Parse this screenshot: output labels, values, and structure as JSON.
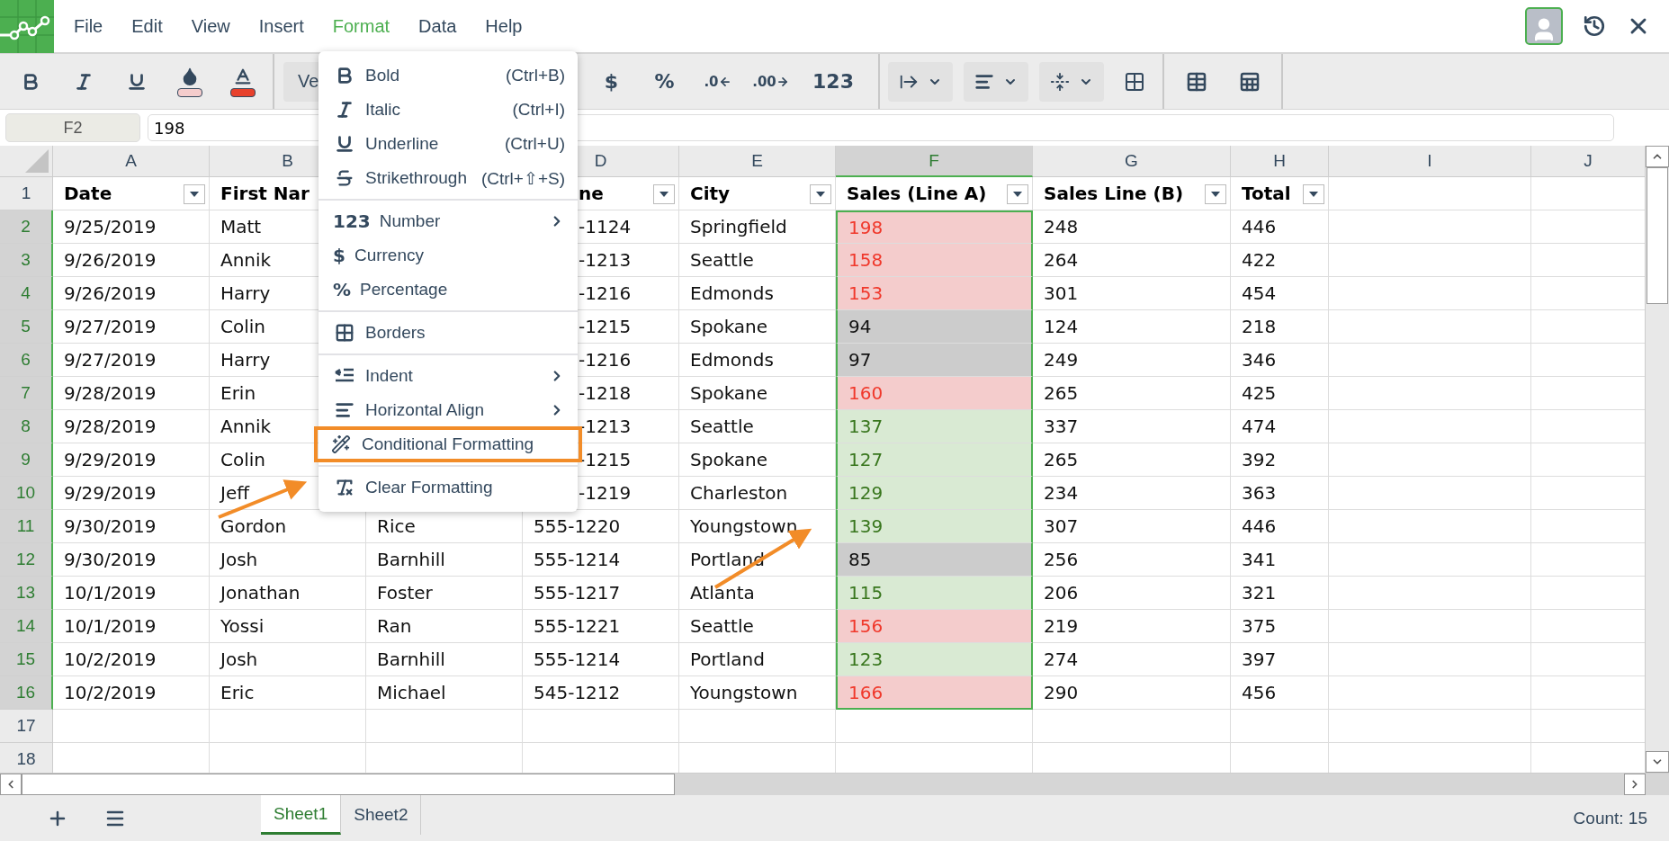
{
  "menu_bar": [
    {
      "label": "File",
      "selected": false
    },
    {
      "label": "Edit",
      "selected": false
    },
    {
      "label": "View",
      "selected": false
    },
    {
      "label": "Insert",
      "selected": false
    },
    {
      "label": "Format",
      "selected": true
    },
    {
      "label": "Data",
      "selected": false
    },
    {
      "label": "Help",
      "selected": false
    }
  ],
  "toolbar": {
    "font_field": "Ve",
    "currency": "$",
    "percent": "%",
    "decrease_decimals": ".0",
    "increase_decimals": ".00",
    "number": "123"
  },
  "name_box": "F2",
  "formula": "198",
  "columns": [
    {
      "label": "A",
      "selected": false
    },
    {
      "label": "B",
      "selected": false
    },
    {},
    {
      "label": "D",
      "selected": false
    },
    {
      "label": "E",
      "selected": false
    },
    {
      "label": "F",
      "selected": true
    },
    {
      "label": "G",
      "selected": false
    },
    {
      "label": "H",
      "selected": false
    },
    {
      "label": "I",
      "selected": false
    },
    {
      "label": "J",
      "selected": false
    }
  ],
  "rows": [
    {
      "number": "1",
      "selected": false,
      "cells": {
        "A": {
          "text": "Date",
          "filter": true
        },
        "B": {
          "text": "First Nar",
          "filter": false
        },
        "D": {
          "text": "ne",
          "filter": true
        },
        "E": {
          "text": "City",
          "filter": true
        },
        "F": {
          "text": "Sales (Line A)",
          "filter": true
        },
        "G": {
          "text": "Sales Line (B)",
          "filter": true
        },
        "H": {
          "text": "Total",
          "filter": true
        }
      }
    },
    {
      "number": "2",
      "selected": true,
      "cells": {
        "A": "9/25/2019",
        "B": "Matt",
        "D": "-1124",
        "E": "Springfield",
        "F": {
          "text": "198",
          "kind": "high"
        },
        "G": "248",
        "H": "446"
      }
    },
    {
      "number": "3",
      "selected": true,
      "cells": {
        "A": "9/26/2019",
        "B": "Annik",
        "D": "-1213",
        "E": "Seattle",
        "F": {
          "text": "158",
          "kind": "high"
        },
        "G": "264",
        "H": "422"
      }
    },
    {
      "number": "4",
      "selected": true,
      "cells": {
        "A": "9/26/2019",
        "B": "Harry",
        "D": "-1216",
        "E": "Edmonds",
        "F": {
          "text": "153",
          "kind": "high"
        },
        "G": "301",
        "H": "454"
      }
    },
    {
      "number": "5",
      "selected": true,
      "cells": {
        "A": "9/27/2019",
        "B": "Colin",
        "D": "-1215",
        "E": "Spokane",
        "F": {
          "text": "94",
          "kind": "low"
        },
        "G": "124",
        "H": "218"
      }
    },
    {
      "number": "6",
      "selected": true,
      "cells": {
        "A": "9/27/2019",
        "B": "Harry",
        "D": "-1216",
        "E": "Edmonds",
        "F": {
          "text": "97",
          "kind": "low"
        },
        "G": "249",
        "H": "346"
      }
    },
    {
      "number": "7",
      "selected": true,
      "cells": {
        "A": "9/28/2019",
        "B": "Erin",
        "D": "-1218",
        "E": "Spokane",
        "F": {
          "text": "160",
          "kind": "high"
        },
        "G": "265",
        "H": "425"
      }
    },
    {
      "number": "8",
      "selected": true,
      "cells": {
        "A": "9/28/2019",
        "B": "Annik",
        "D": "-1213",
        "E": "Seattle",
        "F": {
          "text": "137",
          "kind": "mid"
        },
        "G": "337",
        "H": "474"
      }
    },
    {
      "number": "9",
      "selected": true,
      "cells": {
        "A": "9/29/2019",
        "B": "Colin",
        "D": "-1215",
        "E": "Spokane",
        "F": {
          "text": "127",
          "kind": "mid"
        },
        "G": "265",
        "H": "392"
      }
    },
    {
      "number": "10",
      "selected": true,
      "cells": {
        "A": "9/29/2019",
        "B": "Jeff",
        "D": "-1219",
        "E": "Charleston",
        "F": {
          "text": "129",
          "kind": "mid"
        },
        "G": "234",
        "H": "363"
      }
    },
    {
      "number": "11",
      "selected": true,
      "cells": {
        "A": "9/30/2019",
        "B": "Gordon",
        "C": "Rice",
        "D": "555-1220",
        "E": "Youngstown",
        "F": {
          "text": "139",
          "kind": "mid"
        },
        "G": "307",
        "H": "446"
      }
    },
    {
      "number": "12",
      "selected": true,
      "cells": {
        "A": "9/30/2019",
        "B": "Josh",
        "C": "Barnhill",
        "D": "555-1214",
        "E": "Portland",
        "F": {
          "text": "85",
          "kind": "low"
        },
        "G": "256",
        "H": "341"
      }
    },
    {
      "number": "13",
      "selected": true,
      "cells": {
        "A": "10/1/2019",
        "B": "Jonathan",
        "C": "Foster",
        "D": "555-1217",
        "E": "Atlanta",
        "F": {
          "text": "115",
          "kind": "mid"
        },
        "G": "206",
        "H": "321"
      }
    },
    {
      "number": "14",
      "selected": true,
      "cells": {
        "A": "10/1/2019",
        "B": "Yossi",
        "C": "Ran",
        "D": "555-1221",
        "E": "Seattle",
        "F": {
          "text": "156",
          "kind": "high"
        },
        "G": "219",
        "H": "375"
      }
    },
    {
      "number": "15",
      "selected": true,
      "cells": {
        "A": "10/2/2019",
        "B": "Josh",
        "C": "Barnhill",
        "D": "555-1214",
        "E": "Portland",
        "F": {
          "text": "123",
          "kind": "mid"
        },
        "G": "274",
        "H": "397"
      }
    },
    {
      "number": "16",
      "selected": true,
      "cells": {
        "A": "10/2/2019",
        "B": "Eric",
        "C": "Michael",
        "D": "545-1212",
        "E": "Youngstown",
        "F": {
          "text": "166",
          "kind": "high"
        },
        "G": "290",
        "H": "456"
      }
    },
    {
      "number": "17",
      "selected": false,
      "cells": {}
    },
    {
      "number": "18",
      "selected": false,
      "cells": {}
    }
  ],
  "format_menu": [
    [
      {
        "kind": "bold",
        "label": "Bold",
        "shortcut": "(Ctrl+B)",
        "submenu": false,
        "highlighted": false
      },
      {
        "kind": "italic",
        "label": "Italic",
        "shortcut": "(Ctrl+I)",
        "submenu": false,
        "highlighted": false
      },
      {
        "kind": "underline",
        "label": "Underline",
        "shortcut": "(Ctrl+U)",
        "submenu": false,
        "highlighted": false
      },
      {
        "kind": "strikethrough",
        "label": "Strikethrough",
        "shortcut": "(Ctrl+⇧+S)",
        "submenu": false,
        "highlighted": false
      }
    ],
    [
      {
        "kind": "glyph",
        "glyph": "123",
        "label": "Number",
        "submenu": true,
        "highlighted": false
      },
      {
        "kind": "glyph",
        "glyph": "$",
        "label": "Currency",
        "submenu": false,
        "highlighted": false
      },
      {
        "kind": "glyph",
        "glyph": "%",
        "label": "Percentage",
        "submenu": false,
        "highlighted": false
      }
    ],
    [
      {
        "kind": "borders",
        "label": "Borders",
        "submenu": false,
        "highlighted": false
      }
    ],
    [
      {
        "kind": "indent",
        "label": "Indent",
        "submenu": true,
        "highlighted": false
      },
      {
        "kind": "align",
        "label": "Horizontal Align",
        "submenu": true,
        "highlighted": false
      },
      {
        "kind": "wand",
        "label": "Conditional Formatting",
        "submenu": false,
        "highlighted": true
      }
    ],
    [
      {
        "kind": "clear",
        "label": "Clear Formatting",
        "submenu": false,
        "highlighted": false
      }
    ]
  ],
  "sheets": [
    {
      "label": "Sheet1",
      "selected": true
    },
    {
      "label": "Sheet2",
      "selected": false
    }
  ],
  "status": "Count: 15"
}
